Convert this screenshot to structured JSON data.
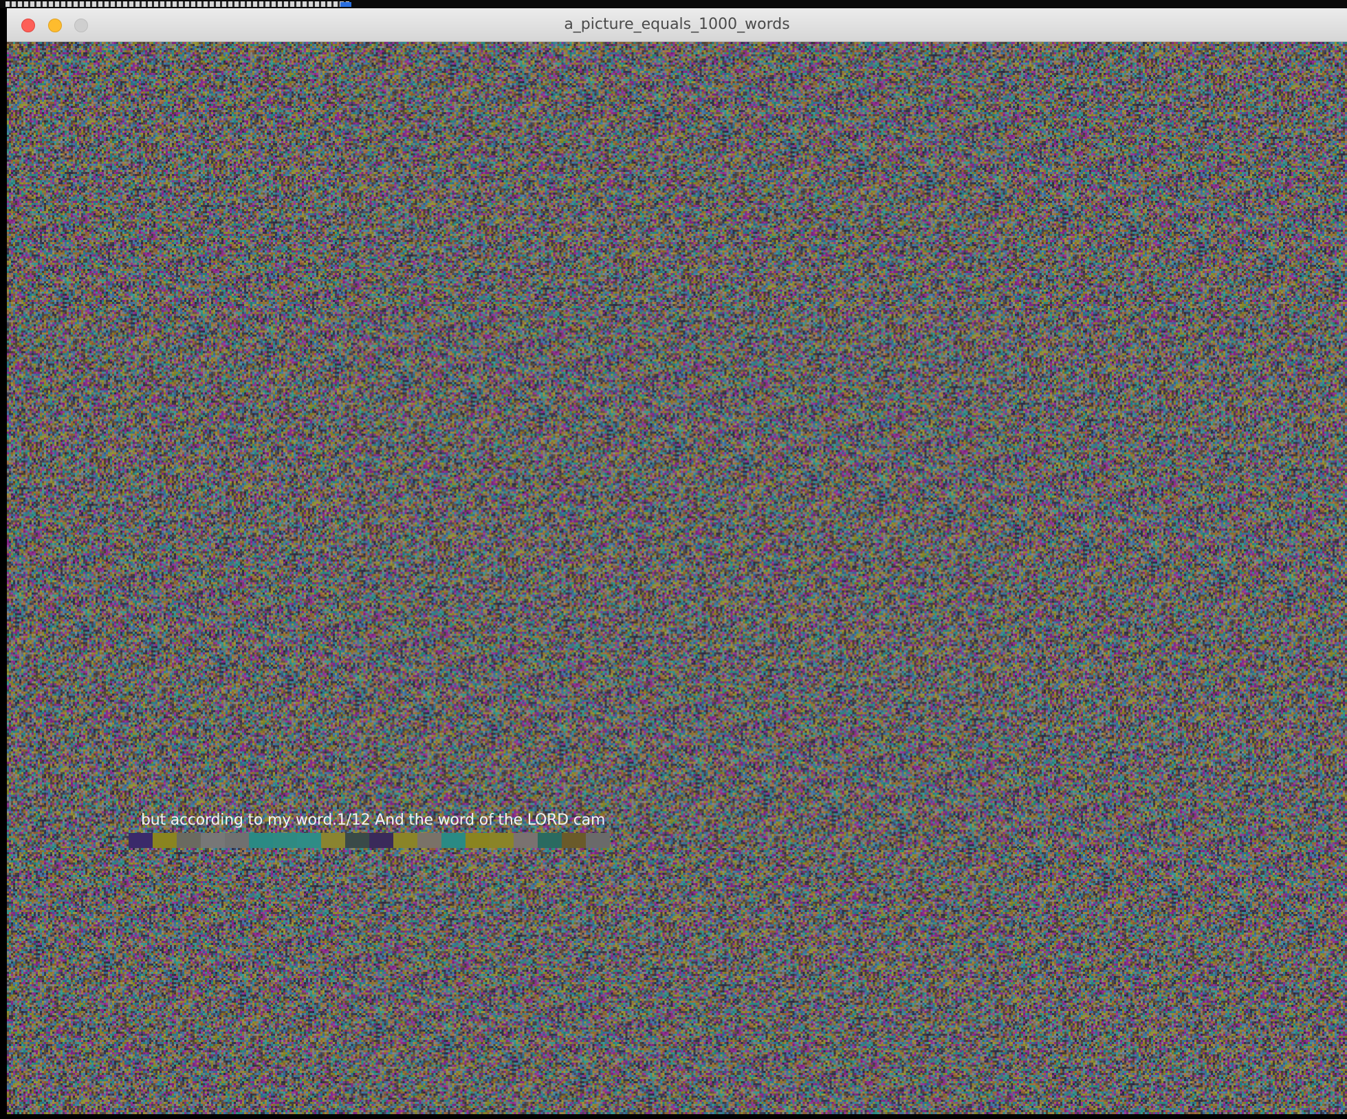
{
  "window": {
    "title": "a_picture_equals_1000_words"
  },
  "traffic_lights": {
    "close_color": "#fd5f57",
    "minimize_color": "#febc2e",
    "zoom_color": "#cfcfcf"
  },
  "canvas": {
    "noise_palette": [
      "#8a2f8c",
      "#2f8c84",
      "#8c8a2f",
      "#3a3a52",
      "#7a7a7a",
      "#5a4a3a",
      "#3f6f9a",
      "#9a6a3f"
    ],
    "caption": "but according to my word.1/12 And the word of the LORD cam",
    "swatches": [
      "#3a2a6a",
      "#8a8420",
      "#6a6a60",
      "#777777",
      "#707070",
      "#2a8a84",
      "#2f8a82",
      "#2f8c86",
      "#8a8430",
      "#3a4a48",
      "#3a2a5a",
      "#8a8428",
      "#7a7268",
      "#2a8a84",
      "#8a8420",
      "#8a8428",
      "#7a7270",
      "#2a6a60",
      "#6a5a2a",
      "#6a6a6a"
    ]
  }
}
